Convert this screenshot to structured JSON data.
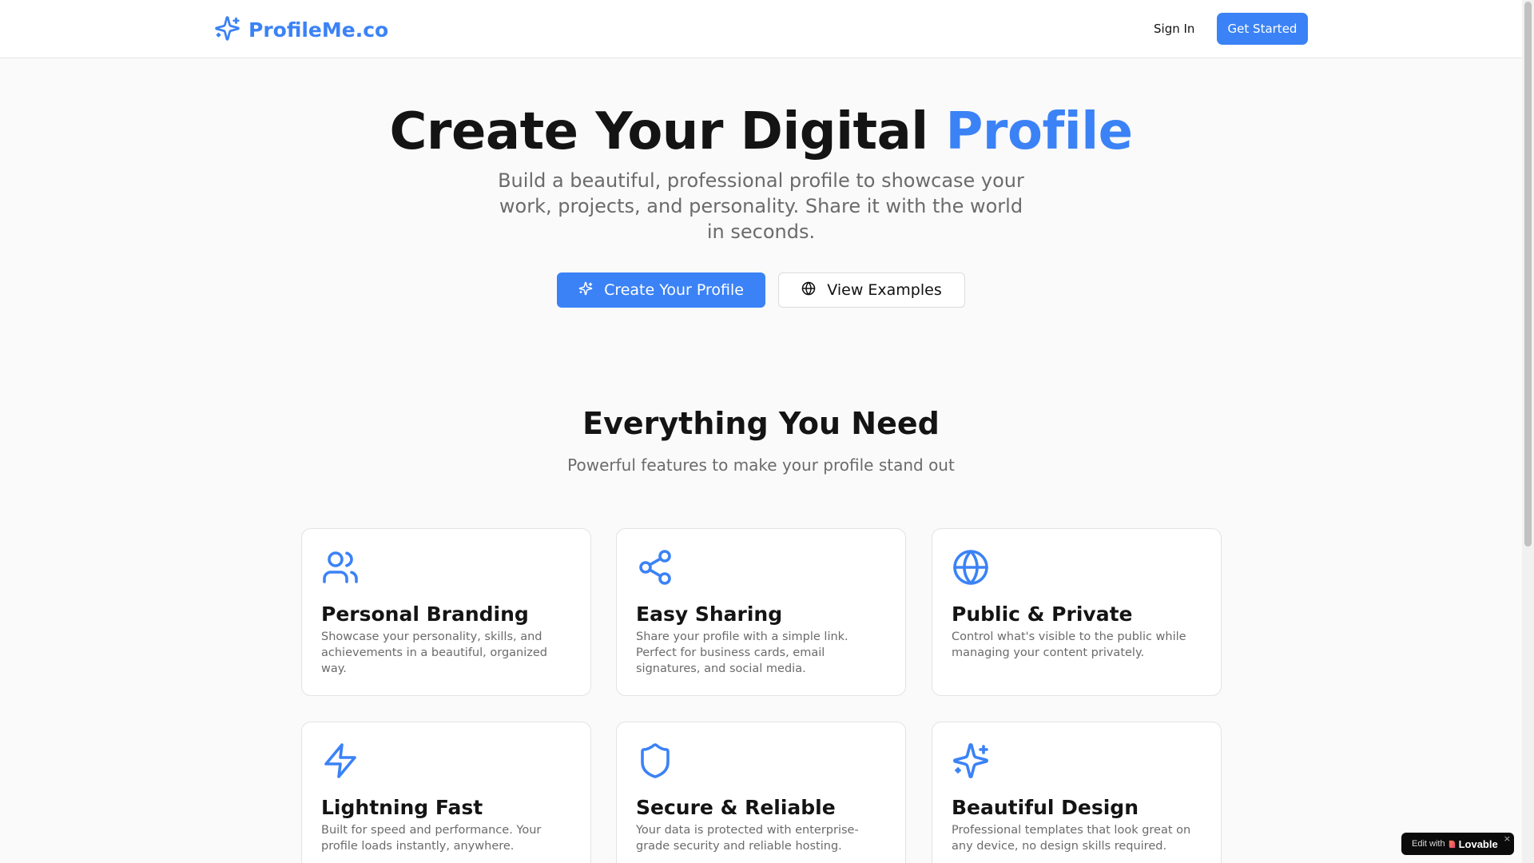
{
  "header": {
    "brand": "ProfileMe.co",
    "sign_in": "Sign In",
    "get_started": "Get Started"
  },
  "hero": {
    "title_main": "Create Your Digital ",
    "title_accent": "Profile",
    "subtitle": "Build a beautiful, professional profile to showcase your work, projects, and personality. Share it with the world in seconds.",
    "primary_button": "Create Your Profile",
    "secondary_button": "View Examples"
  },
  "features": {
    "title": "Everything You Need",
    "subtitle": "Powerful features to make your profile stand out",
    "cards": [
      {
        "icon": "users-icon",
        "title": "Personal Branding",
        "desc": "Showcase your personality, skills, and achievements in a beautiful, organized way."
      },
      {
        "icon": "share-icon",
        "title": "Easy Sharing",
        "desc": "Share your profile with a simple link. Perfect for business cards, email signatures, and social media."
      },
      {
        "icon": "globe-icon",
        "title": "Public & Private",
        "desc": "Control what's visible to the public while managing your content privately."
      },
      {
        "icon": "lightning-icon",
        "title": "Lightning Fast",
        "desc": "Built for speed and performance. Your profile loads instantly, anywhere."
      },
      {
        "icon": "shield-icon",
        "title": "Secure & Reliable",
        "desc": "Your data is protected with enterprise-grade security and reliable hosting."
      },
      {
        "icon": "sparkles-icon",
        "title": "Beautiful Design",
        "desc": "Professional templates that look great on any device, no design skills required."
      }
    ]
  },
  "badge": {
    "edit_with": "Edit with",
    "brand": "Lovable",
    "close": "×"
  },
  "colors": {
    "accent": "#3b82f6",
    "text": "#141414",
    "muted": "#6b6b6b"
  }
}
